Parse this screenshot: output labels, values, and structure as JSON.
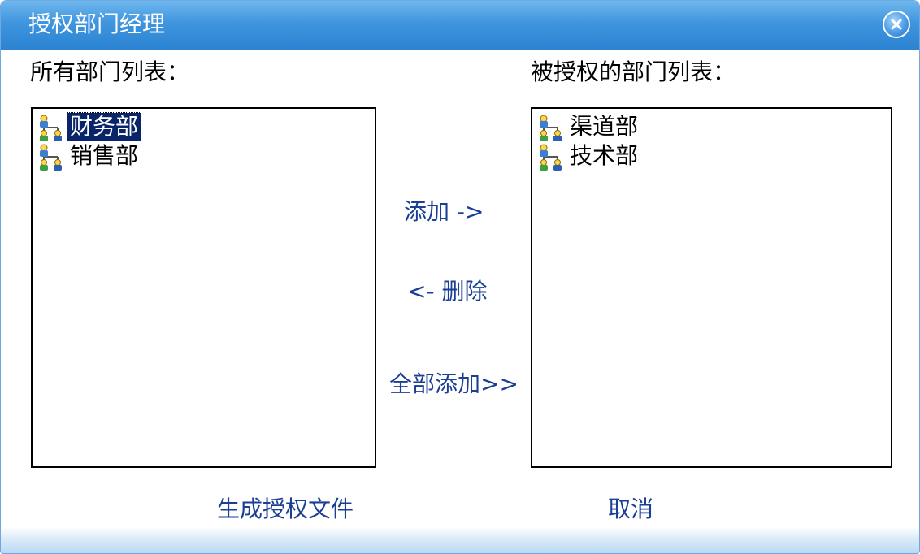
{
  "dialog": {
    "title": "授权部门经理",
    "close_icon": "close-icon"
  },
  "available_list": {
    "label": "所有部门列表：",
    "items": [
      {
        "label": "财务部",
        "icon": "department-icon",
        "selected": true
      },
      {
        "label": "销售部",
        "icon": "department-icon",
        "selected": false
      }
    ]
  },
  "authorized_list": {
    "label": "被授权的部门列表：",
    "items": [
      {
        "label": "渠道部",
        "icon": "department-icon",
        "selected": false
      },
      {
        "label": "技术部",
        "icon": "department-icon",
        "selected": false
      }
    ]
  },
  "actions": {
    "add": "添加 ->",
    "remove": "<- 删除",
    "add_all": "全部添加>>"
  },
  "footer": {
    "generate": "生成授权文件",
    "cancel": "取消"
  },
  "colors": {
    "title_bar": "#3f95de",
    "link": "#1a3f95",
    "selection": "#0a246a"
  }
}
